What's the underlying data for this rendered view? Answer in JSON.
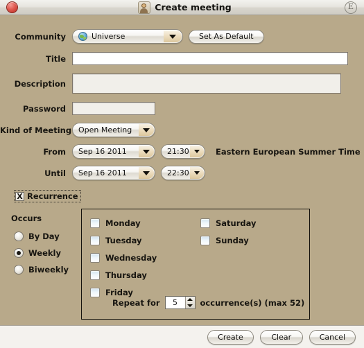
{
  "window": {
    "title": "Create meeting",
    "close_icon": "close-button-orb",
    "title_icon": "user-avatar-icon",
    "right_icon": "circled-e-icon",
    "background_color": "#b8a98a"
  },
  "form": {
    "community": {
      "label": "Community",
      "value": "Universe",
      "icon": "globe-icon",
      "set_default_button": "Set As Default"
    },
    "title": {
      "label": "Title",
      "value": "",
      "placeholder": ""
    },
    "description": {
      "label": "Description",
      "value": "",
      "placeholder": ""
    },
    "password": {
      "label": "Password",
      "value": "",
      "placeholder": ""
    },
    "kind_of_meeting": {
      "label": "Kind of Meeting",
      "value": "Open Meeting"
    },
    "from": {
      "label": "From",
      "date": "Sep 16 2011",
      "time": "21:30"
    },
    "until": {
      "label": "Until",
      "date": "Sep 16 2011",
      "time": "22:30"
    },
    "timezone": "Eastern European Summer Time"
  },
  "recurrence": {
    "label": "Recurrence",
    "checked": true,
    "check_glyph": "X",
    "occurs_label": "Occurs",
    "options": [
      {
        "label": "By Day",
        "selected": false
      },
      {
        "label": "Weekly",
        "selected": true
      },
      {
        "label": "Biweekly",
        "selected": false
      }
    ],
    "days_column_1": [
      {
        "label": "Monday",
        "checked": false
      },
      {
        "label": "Tuesday",
        "checked": false
      },
      {
        "label": "Wednesday",
        "checked": false
      },
      {
        "label": "Thursday",
        "checked": false
      },
      {
        "label": "Friday",
        "checked": false
      }
    ],
    "days_column_2": [
      {
        "label": "Saturday",
        "checked": false
      },
      {
        "label": "Sunday",
        "checked": false
      }
    ],
    "repeat": {
      "prefix_label": "Repeat for",
      "value": "5",
      "suffix_label": "occurrence(s) (max 52)"
    }
  },
  "footer": {
    "create_label": "Create",
    "clear_label": "Clear",
    "cancel_label": "Cancel"
  }
}
